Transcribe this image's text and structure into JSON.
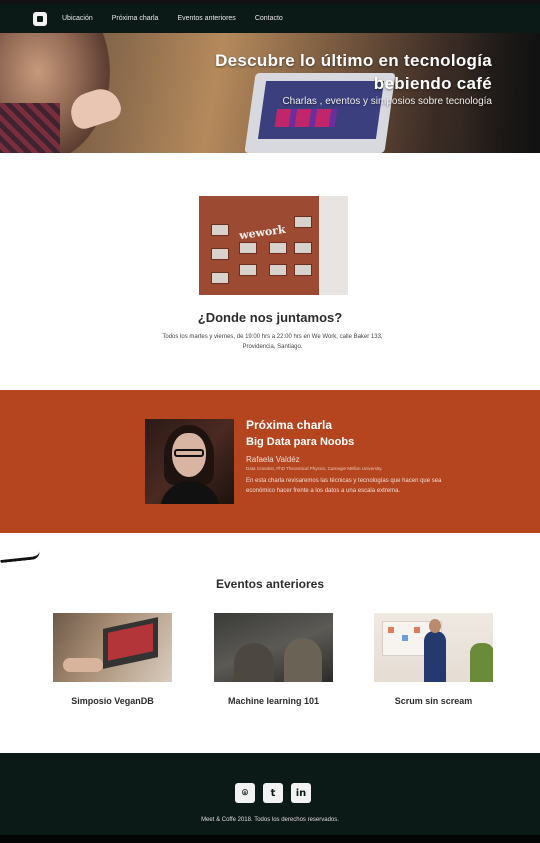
{
  "nav": {
    "logo_icon": "coffee-cup-icon",
    "links": [
      "Ubicación",
      "Próxima charla",
      "Eventos anteriores",
      "Contacto"
    ]
  },
  "hero": {
    "title": "Descubre lo último en tecnología bebiendo café",
    "subtitle": "Charlas , eventos y simposios sobre tecnología"
  },
  "location": {
    "sign": "wework",
    "title": "¿Donde nos juntamos?",
    "text": "Todos los martes y viernes, de 19:00 hrs a 22:00 hrs en We Work, calle Baker 133, Providencia, Santiago."
  },
  "next_talk": {
    "label": "Próxima charla",
    "title": "Big Data para Noobs",
    "speaker": "Rafaela Valdéz",
    "credentials": "Data Scientist,  PhD Theoretical Physics, Carnegie Mellon University.",
    "description": "En esta charla revisaremos las técnicas y tecnologías que hacen que sea económico hacer frente a los datos a una escala extrema."
  },
  "past_events": {
    "title": "Eventos anteriores",
    "items": [
      "Simposio VeganDB",
      "Machine learning 101",
      "Scrum sin scream"
    ]
  },
  "footer": {
    "social": [
      {
        "icon": "github-icon",
        "glyph": "⌾"
      },
      {
        "icon": "twitter-icon",
        "glyph": "t"
      },
      {
        "icon": "linkedin-icon",
        "glyph": "in"
      }
    ],
    "copyright": "Meet & Coffe 2018. Todos los derechos reservados."
  },
  "colors": {
    "nav_bg": "#0c1a17",
    "accent": "#b4451f"
  }
}
